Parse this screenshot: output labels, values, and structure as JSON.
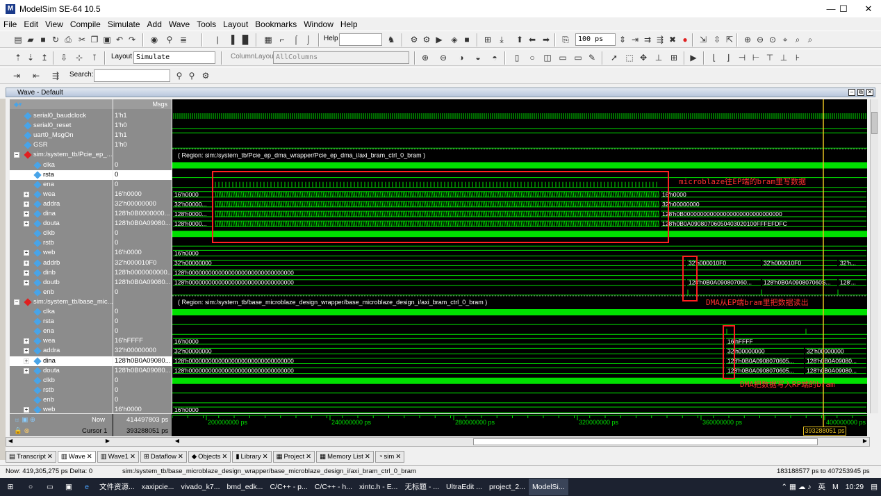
{
  "title": "ModelSim SE-64 10.5",
  "window_controls": [
    "—",
    "☐",
    "✕"
  ],
  "menu": [
    "File",
    "Edit",
    "View",
    "Compile",
    "Simulate",
    "Add",
    "Wave",
    "Tools",
    "Layout",
    "Bookmarks",
    "Window",
    "Help"
  ],
  "toolbar": {
    "help_label": "Help",
    "time_value": "100 ps",
    "layout_label": "Layout",
    "layout_value": "Simulate",
    "col_layout_label": "ColumnLayout",
    "col_layout_value": "AllColumns",
    "search_label": "Search:"
  },
  "wave_title": "Wave - Default",
  "msgs_header": "Msgs",
  "signals": [
    {
      "name": "serial0_baudclock",
      "value": "1'h1"
    },
    {
      "name": "serial0_reset",
      "value": "1'h0"
    },
    {
      "name": "uart0_MsgOn",
      "value": "1'h1"
    },
    {
      "name": "GSR",
      "value": "1'h0"
    },
    {
      "name": "sim:/system_tb/Pcie_ep_...",
      "value": ""
    },
    {
      "name": "clka",
      "value": "0"
    },
    {
      "name": "rsta",
      "value": "0"
    },
    {
      "name": "ena",
      "value": "0"
    },
    {
      "name": "wea",
      "value": "16'h0000"
    },
    {
      "name": "addra",
      "value": "32'h00000000"
    },
    {
      "name": "dina",
      "value": "128'h0B0000000..."
    },
    {
      "name": "douta",
      "value": "128'h0B0A09080..."
    },
    {
      "name": "clkb",
      "value": "0"
    },
    {
      "name": "rstb",
      "value": "0"
    },
    {
      "name": "web",
      "value": "16'h0000"
    },
    {
      "name": "addrb",
      "value": "32'h000010F0"
    },
    {
      "name": "dinb",
      "value": "128'h0000000000..."
    },
    {
      "name": "doutb",
      "value": "128'h0B0A09080..."
    },
    {
      "name": "enb",
      "value": "0"
    },
    {
      "name": "sim:/system_tb/base_mic...",
      "value": ""
    },
    {
      "name": "clka",
      "value": "0"
    },
    {
      "name": "rsta",
      "value": "0"
    },
    {
      "name": "ena",
      "value": "0"
    },
    {
      "name": "wea",
      "value": "16'hFFFF"
    },
    {
      "name": "addra",
      "value": "32'h00000000"
    },
    {
      "name": "dina",
      "value": "128'h0B0A09080..."
    },
    {
      "name": "douta",
      "value": "128'h0B0A09080..."
    },
    {
      "name": "clkb",
      "value": "0"
    },
    {
      "name": "rstb",
      "value": "0"
    },
    {
      "name": "enb",
      "value": "0"
    },
    {
      "name": "web",
      "value": "16'h0000"
    }
  ],
  "wave_text": {
    "region1": "( Region: sim:/system_tb/Pcie_ep_dma_wrapper/Pcie_ep_dma_i/axi_bram_ctrl_0_bram )",
    "region2": "( Region: sim:/system_tb/base_microblaze_design_wrapper/base_microblaze_design_i/axi_bram_ctrl_0_bram )",
    "wea1_l": "16'h0000",
    "wea1_r": "16'h0000",
    "addra1_l": "32'h00000...",
    "addra1_r": "32'h00000000",
    "dina1_l": "128'h0000...",
    "dina1_r": "128'h0B000000000000000000000000000000",
    "douta1_l": "128'h0000...",
    "douta1_r": "128'h0B0A09080706050403020100FFFEFDFC",
    "web_l": "16'h0000",
    "addrb_l": "32'h00000000",
    "addrb_m": "32'h000010F0",
    "addrb_n": "32'h000010F0",
    "addrb_r": "32'h...",
    "dinb_l": "128'h00000000000000000000000000000000",
    "doutb_l": "128'h00000000000000000000000000000000",
    "doutb_m": "128'h0B0A090807060...",
    "doutb_n": "128'h0B0A090807060S...",
    "doutb_r": "128'...",
    "wea2_l": "16'h0000",
    "wea2_r": "16'hFFFF",
    "addra2_l": "32'h00000000",
    "addra2_m": "32'h00000000",
    "addra2_r": "32'h00000000",
    "dina2_l": "128'h00000000000000000000000000000000",
    "dina2_m": "128'h0B0A0908070605...",
    "dina2_r": "128'h0B0A09080...",
    "douta2_l": "128'h00000000000000000000000000000000",
    "douta2_m": "128'h0B0A0908070605...",
    "douta2_r": "128'h0B0A09080...",
    "web2_l": "16'h0000"
  },
  "annotations": {
    "a1": "microblaze往EP端的bram里写数据",
    "a2": "DMA从EP端bram里把数据读出",
    "a3": "DMA把数据写入RP端的bram"
  },
  "cursor": {
    "now_label": "Now",
    "now_value": "414497803 ps",
    "cursor_label": "Cursor 1",
    "cursor_value": "393288051 ps",
    "cursor_flag": "393288051 ps"
  },
  "time_ticks": [
    "200000000 ps",
    "240000000 ps",
    "280000000 ps",
    "320000000 ps",
    "360000000 ps",
    "400000000 ps"
  ],
  "tabs": [
    "Transcript",
    "Wave",
    "Wave1",
    "Dataflow",
    "Objects",
    "Library",
    "Project",
    "Memory List",
    "sim"
  ],
  "status": {
    "now": "Now: 419,305,275 ps  Delta: 0",
    "path": "sim:/system_tb/base_microblaze_design_wrapper/base_microblaze_design_i/axi_bram_ctrl_0_bram",
    "range": "183188577 ps to 407253945 ps"
  },
  "taskbar": [
    "文件资源...",
    "xaxipcie...",
    "vivado_k7...",
    "bmd_edk...",
    "C/C++ - p...",
    "C/C++ - h...",
    "xintc.h - E...",
    "无标题 - ...",
    "UltraEdit ...",
    "project_2...",
    "ModelSi..."
  ],
  "tray": {
    "ime": "英",
    "time": "10:29"
  }
}
